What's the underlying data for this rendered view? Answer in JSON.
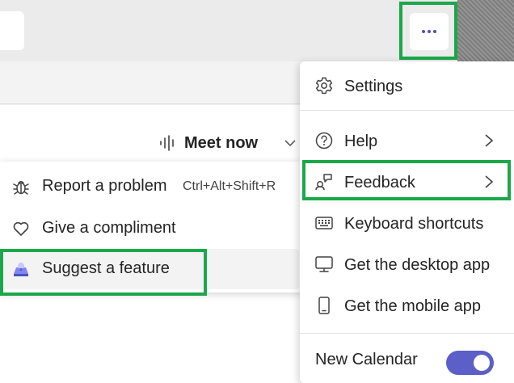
{
  "header": {
    "more_button": "more-options"
  },
  "meeting": {
    "meet_now_label": "Meet now"
  },
  "feedback_submenu": {
    "items": [
      {
        "label": "Report a problem",
        "shortcut": "Ctrl+Alt+Shift+R",
        "icon": "bug-icon"
      },
      {
        "label": "Give a compliment",
        "icon": "heart-icon"
      },
      {
        "label": "Suggest a feature",
        "icon": "lightbulb-box-icon"
      }
    ]
  },
  "menu": {
    "settings_label": "Settings",
    "help_label": "Help",
    "feedback_label": "Feedback",
    "keyboard_shortcuts_label": "Keyboard shortcuts",
    "desktop_app_label": "Get the desktop app",
    "mobile_app_label": "Get the mobile app",
    "new_calendar_label": "New Calendar",
    "new_calendar_enabled": true
  },
  "colors": {
    "accent": "#5b5fc7",
    "highlight": "#1aa84a",
    "dots": "#4f52b2"
  }
}
